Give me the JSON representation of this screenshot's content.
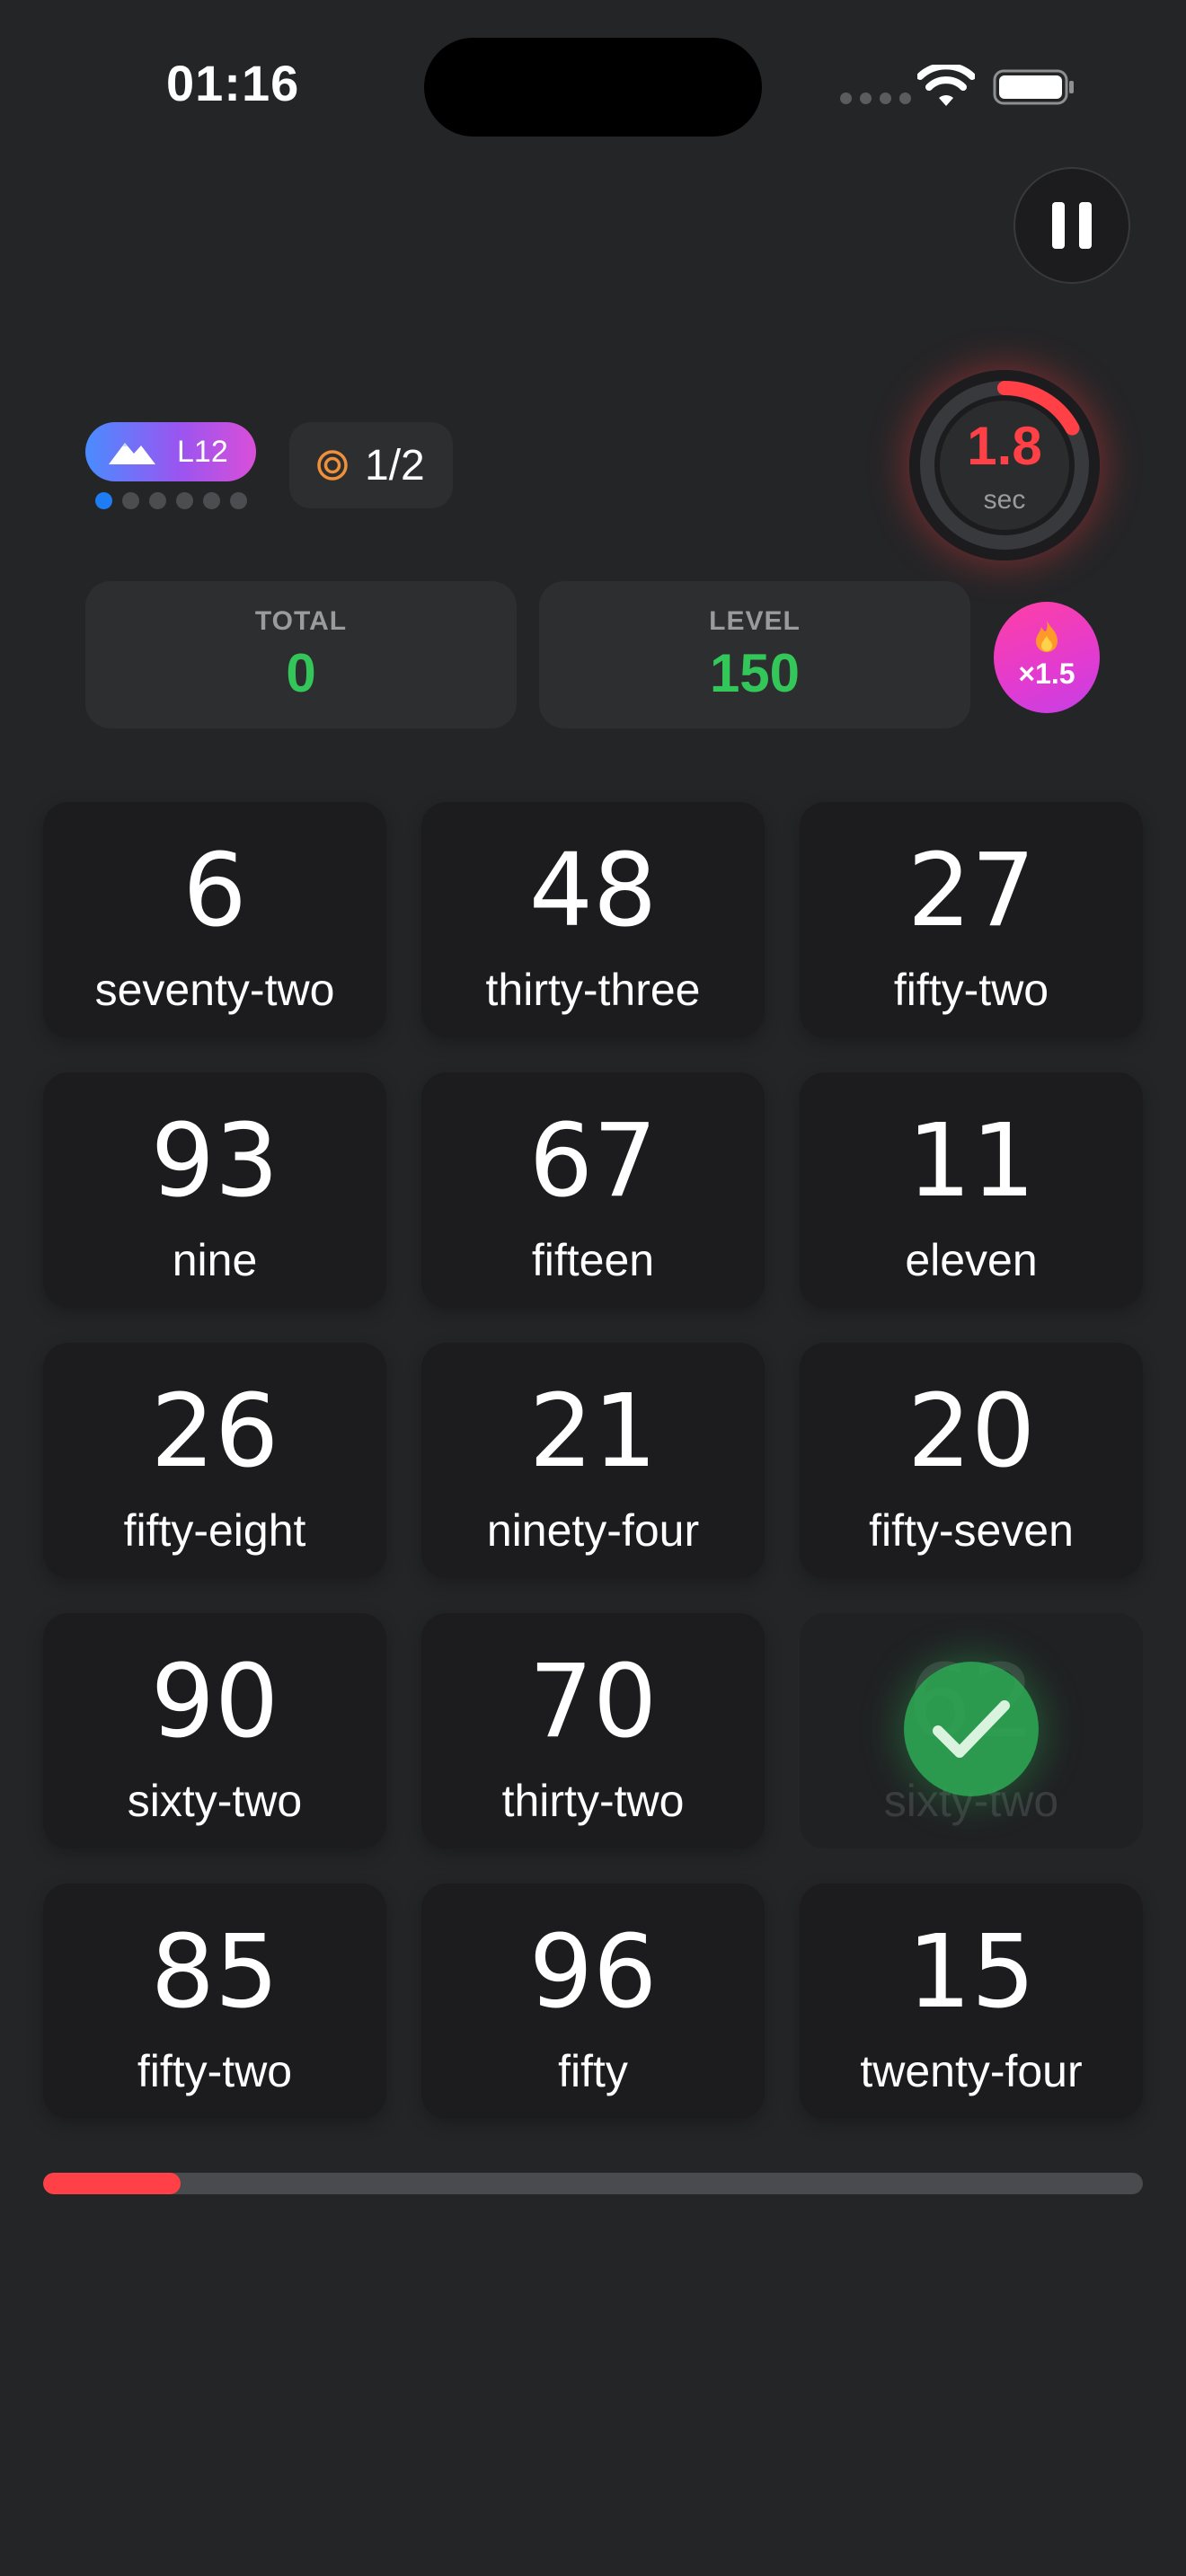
{
  "status_bar": {
    "time": "01:16"
  },
  "hud": {
    "level_badge": {
      "label": "L12",
      "dots_total": 6,
      "dots_active": 1
    },
    "target": {
      "value": "1/2"
    },
    "timer": {
      "value": "1.8",
      "unit": "sec",
      "remaining_fraction": 0.17
    },
    "scores": [
      {
        "label": "TOTAL",
        "value": "0"
      },
      {
        "label": "LEVEL",
        "value": "150"
      }
    ],
    "multiplier": "×1.5"
  },
  "grid": {
    "tiles": [
      {
        "number": "6",
        "word": "seventy-two",
        "done": false
      },
      {
        "number": "48",
        "word": "thirty-three",
        "done": false
      },
      {
        "number": "27",
        "word": "fifty-two",
        "done": false
      },
      {
        "number": "93",
        "word": "nine",
        "done": false
      },
      {
        "number": "67",
        "word": "fifteen",
        "done": false
      },
      {
        "number": "11",
        "word": "eleven",
        "done": false
      },
      {
        "number": "26",
        "word": "fifty-eight",
        "done": false
      },
      {
        "number": "21",
        "word": "ninety-four",
        "done": false
      },
      {
        "number": "20",
        "word": "fifty-seven",
        "done": false
      },
      {
        "number": "90",
        "word": "sixty-two",
        "done": false
      },
      {
        "number": "70",
        "word": "thirty-two",
        "done": false
      },
      {
        "number": "62",
        "word": "sixty-two",
        "done": true
      },
      {
        "number": "85",
        "word": "fifty-two",
        "done": false
      },
      {
        "number": "96",
        "word": "fifty",
        "done": false
      },
      {
        "number": "15",
        "word": "twenty-four",
        "done": false
      }
    ]
  },
  "progress": {
    "fraction": 0.125
  },
  "colors": {
    "accent_red": "#ff4046",
    "score_green": "#32c758",
    "check_green": "#2caa54",
    "badge_blue": "#4a8cff",
    "badge_pink": "#d94fd8"
  },
  "icons": [
    "wifi-icon",
    "battery-icon",
    "pause-icon",
    "mountain-icon",
    "target-icon",
    "flame-icon",
    "checkmark-icon"
  ]
}
